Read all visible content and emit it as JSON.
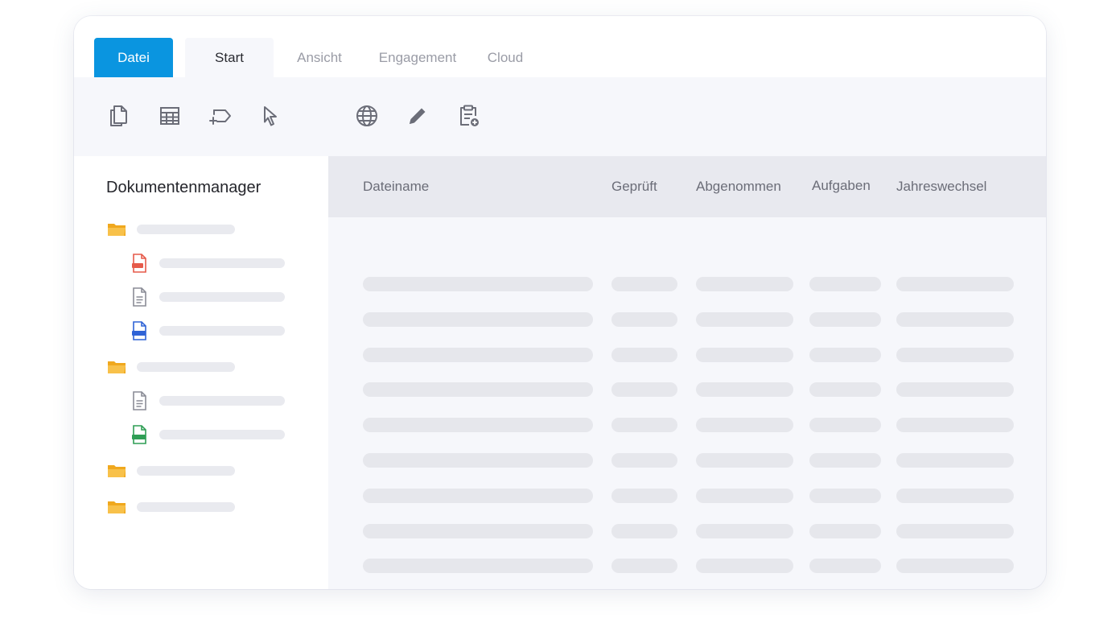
{
  "tabs": [
    {
      "label": "Datei",
      "state": "active"
    },
    {
      "label": "Start",
      "state": "selected"
    },
    {
      "label": "Ansicht",
      "state": "inactive"
    },
    {
      "label": "Engagement",
      "state": "inactive"
    },
    {
      "label": "Cloud",
      "state": "inactive"
    }
  ],
  "toolbar": {
    "icons": [
      "copy-documents-icon",
      "table-grid-icon",
      "add-label-icon",
      "cursor-pointer-icon",
      "globe-icon",
      "pencil-icon",
      "clipboard-add-icon"
    ]
  },
  "sidebar": {
    "title": "Dokumentenmanager",
    "tree": [
      {
        "type": "folder",
        "icon": "folder-icon"
      },
      {
        "type": "file",
        "icon": "pdf-file-icon",
        "badge": "PDF"
      },
      {
        "type": "file",
        "icon": "text-file-icon"
      },
      {
        "type": "file",
        "icon": "docx-file-icon",
        "badge": "DOCX"
      },
      {
        "type": "folder",
        "icon": "folder-icon"
      },
      {
        "type": "file",
        "icon": "text-file-icon"
      },
      {
        "type": "file",
        "icon": "xlsx-file-icon",
        "badge": "XLSX"
      },
      {
        "type": "folder",
        "icon": "folder-icon"
      },
      {
        "type": "folder",
        "icon": "folder-icon"
      }
    ]
  },
  "table": {
    "columns": [
      "Dateiname",
      "Geprüft",
      "Abgenommen",
      "Aufgaben",
      "Jahreswechsel"
    ],
    "row_count": 9
  },
  "colors": {
    "accent": "#0a95e0",
    "folder": "#f5b731",
    "pdf": "#e65a4a",
    "docx": "#2f63d6",
    "xlsx": "#2f9e55",
    "placeholder": "#e6e7ec"
  }
}
